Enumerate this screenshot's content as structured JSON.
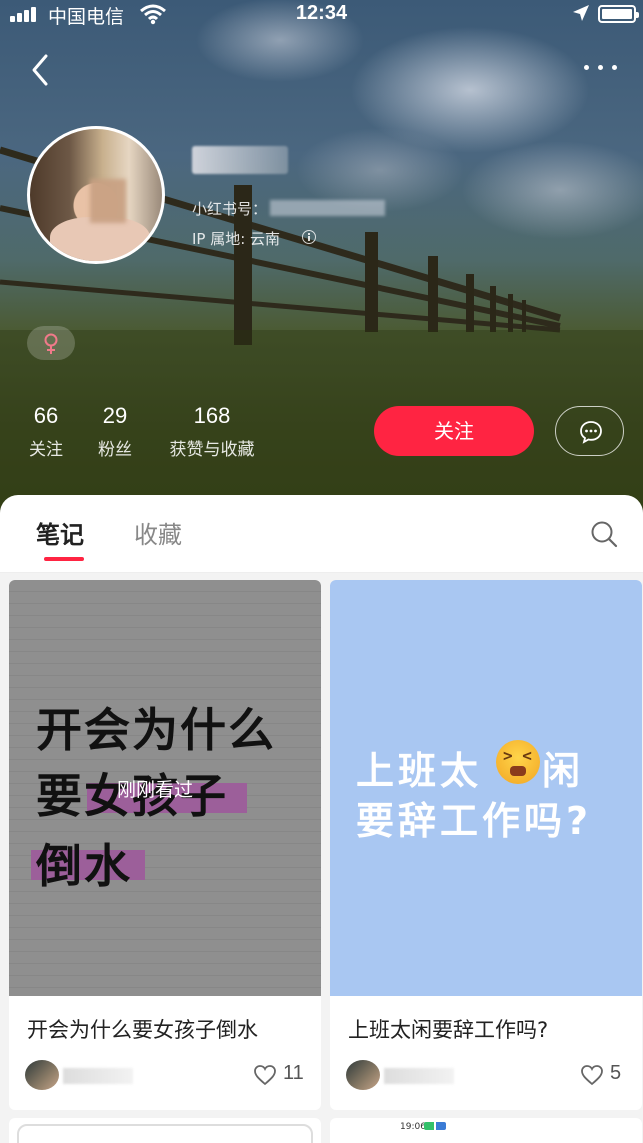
{
  "status_bar": {
    "carrier": "中国电信",
    "time": "12:34"
  },
  "profile": {
    "redbook_id_label": "小红书号：",
    "ip_location": "IP 属地: 云南"
  },
  "stats": [
    {
      "value": "66",
      "label": "关注"
    },
    {
      "value": "29",
      "label": "粉丝"
    },
    {
      "value": "168",
      "label": "获赞与收藏"
    }
  ],
  "actions": {
    "follow_label": "关注"
  },
  "tabs": [
    {
      "label": "笔记",
      "active": true
    },
    {
      "label": "收藏",
      "active": false
    }
  ],
  "notes": [
    {
      "cover_lines": [
        "开会为什么",
        "要女孩子",
        "倒水"
      ],
      "overlay": "刚刚看过",
      "title": "开会为什么要女孩子倒水",
      "likes": "11"
    },
    {
      "cover_lines": [
        "上班太",
        "闲",
        "要辞工作吗?"
      ],
      "title": "上班太闲要辞工作吗?",
      "likes": "5"
    }
  ],
  "peek": {
    "time": "19:06"
  },
  "colors": {
    "accent": "#ff2442",
    "cover_blue": "#a9c7f2",
    "cover_gray": "#8f8f8f",
    "highlight": "#9c5f9a"
  },
  "icons": [
    "signal-icon",
    "wifi-icon",
    "location-arrow-icon",
    "battery-icon",
    "back-chevron-icon",
    "more-dots-icon",
    "info-icon",
    "female-icon",
    "message-icon",
    "search-icon",
    "heart-icon",
    "emoji-icon"
  ]
}
